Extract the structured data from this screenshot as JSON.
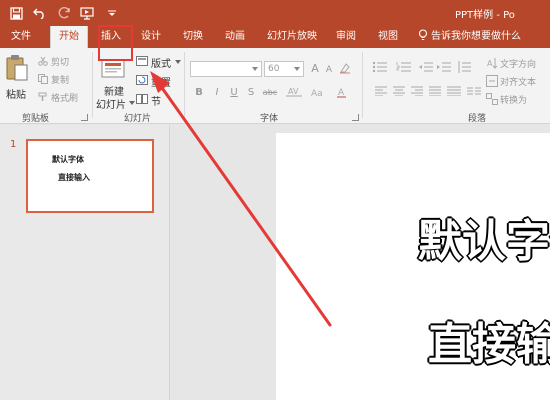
{
  "titlebar": {
    "doc_title": "PPT样例 - Po",
    "icons": [
      "save-icon",
      "undo-icon",
      "redo-icon",
      "start-from-beginning-icon",
      "customize-qat-icon"
    ]
  },
  "tabs": [
    {
      "label": "文件",
      "active": false
    },
    {
      "label": "开始",
      "active": true
    },
    {
      "label": "插入",
      "active": false
    },
    {
      "label": "设计",
      "active": false
    },
    {
      "label": "切换",
      "active": false
    },
    {
      "label": "动画",
      "active": false
    },
    {
      "label": "幻灯片放映",
      "active": false
    },
    {
      "label": "审阅",
      "active": false
    },
    {
      "label": "视图",
      "active": false
    }
  ],
  "tell_me": "告诉我你想要做什么",
  "ribbon": {
    "clipboard": {
      "paste": "粘贴",
      "cut": "剪切",
      "copy": "复制",
      "format_painter": "格式刷",
      "group_label": "剪贴板"
    },
    "slides": {
      "new_slide_line1": "新建",
      "new_slide_line2": "幻灯片",
      "layout": "版式",
      "reset": "重置",
      "section": "节",
      "group_label": "幻灯片"
    },
    "font": {
      "font_name_value": "",
      "font_size_value": "60",
      "bold": "B",
      "italic": "I",
      "underline": "U",
      "shadow": "S",
      "strikethrough": "abc",
      "grow": "A",
      "shrink": "A",
      "group_label": "字体"
    },
    "paragraph": {
      "text_direction": "文字方向",
      "align_text": "对齐文本",
      "convert_smartart": "转换为",
      "group_label": "段落"
    }
  },
  "slide_panel": {
    "slide_number": "1",
    "thumb_line1": "默认字体",
    "thumb_line2": "直接输入"
  },
  "slide": {
    "line1": "默认字体",
    "line2": "直接输入"
  },
  "colors": {
    "brand": "#b7472a",
    "annotation_red": "#e53935"
  }
}
